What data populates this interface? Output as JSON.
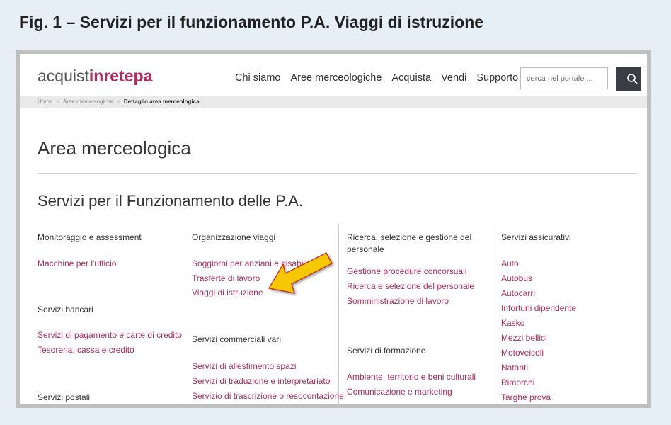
{
  "figure_title": "Fig. 1 – Servizi per il funzionamento P.A. Viaggi di istruzione",
  "header": {
    "logo_prefix": "acquist",
    "logo_in": "in",
    "logo_rete": "rete",
    "logo_pa": "pa",
    "nav": [
      "Chi siamo",
      "Aree merceologiche",
      "Acquista",
      "Vendi",
      "Supporto"
    ],
    "search_placeholder": "cerca nel portale ..."
  },
  "breadcrumb": {
    "home": "Home",
    "sep1": ">",
    "aree": "Aree merceologiche",
    "sep2": ">",
    "current": "Dettaglio area merceologica"
  },
  "page_title": "Area merceologica",
  "section_title": "Servizi per il Funzionamento delle P.A.",
  "columns": {
    "col1": {
      "heading1": "Monitoraggio e assessment",
      "link1": "Macchine per l'ufficio",
      "heading2": "Servizi bancari",
      "link2": "Servizi di pagamento e carte di credito",
      "link3": "Tesoreria, cassa e credito",
      "heading3": "Servizi postali"
    },
    "col2": {
      "heading1": "Organizzazione viaggi",
      "link1": "Soggiorni per anziani e disabili",
      "link2": "Trasferte di lavoro",
      "link3": "Viaggi di istruzione",
      "heading2": "Servizi commerciali vari",
      "link4": "Servizi di allestimento spazi",
      "link5": "Servizi di traduzione e interpretariato",
      "link6": "Servizio di trascrizione o resocontazione"
    },
    "col3": {
      "heading1_line1": "Ricerca, selezione e gestione del",
      "heading1_line2": "personale",
      "link1": "Gestione procedure concorsuali",
      "link2": "Ricerca e selezione del personale",
      "link3": "Somministrazione di lavoro",
      "heading2": "Servizi di formazione",
      "link4": "Ambiente, territorio e beni culturali",
      "link5": "Comunicazione e marketing"
    },
    "col4": {
      "heading1": "Servizi assicurativi",
      "links": [
        "Auto",
        "Autobus",
        "Autocarri",
        "Infortuni dipendente",
        "Kasko",
        "Mezzi bellici",
        "Motoveicoli",
        "Natanti",
        "Rimorchi",
        "Targhe prova"
      ]
    }
  },
  "colors": {
    "accent": "#b02c57",
    "arrow_fill": "#f5c800",
    "arrow_outline": "#c0392b"
  },
  "icons": {
    "search": "magnifier-icon",
    "arrow": "highlight-arrow-icon"
  }
}
